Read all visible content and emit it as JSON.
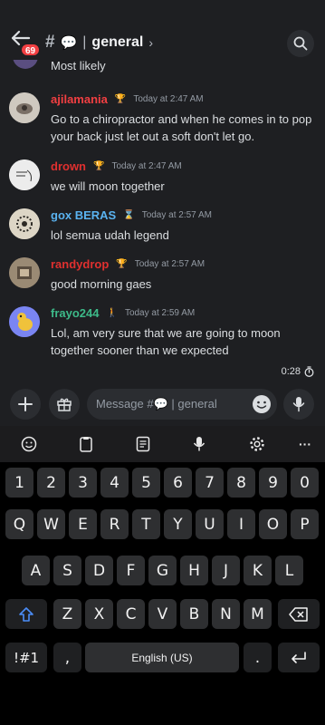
{
  "header": {
    "badge": "69",
    "channel_emoji": "💬",
    "separator": "|",
    "channel_name": "general",
    "chevron": "›"
  },
  "chat": {
    "previous_text": "Most likely",
    "messages": [
      {
        "username": "ajilamania",
        "color": "#f23f42",
        "role_icon": "🏆",
        "time": "Today at 2:47 AM",
        "text": "Go to a chiropractor and when he comes in to pop your back just let out a soft don't let go."
      },
      {
        "username": "drown",
        "color": "#e0302f",
        "role_icon": "🏆",
        "time": "Today at 2:47 AM",
        "text": "we will moon together"
      },
      {
        "username": "gox BERAS",
        "color": "#5ab3f0",
        "role_icon": "⌛",
        "time": "Today at 2:57 AM",
        "text": "lol semua udah legend"
      },
      {
        "username": "randydrop",
        "color": "#e0302f",
        "role_icon": "🏆",
        "time": "Today at 2:57 AM",
        "text": "good morning gaes"
      },
      {
        "username": "frayo244",
        "color": "#3dba89",
        "role_icon": "🚶",
        "time": "Today at 2:59 AM",
        "text": "Lol, am very sure that we are going to moon together sooner than we expected"
      }
    ],
    "timer": "0:28"
  },
  "composer": {
    "placeholder": "Message #💬 | general"
  },
  "keyboard": {
    "toolbar_icons": [
      "emoji-icon",
      "clipboard-icon",
      "keyboard-layout-icon",
      "mic-icon",
      "settings-icon",
      "more-icon"
    ],
    "more_label": "···",
    "row1": [
      "1",
      "2",
      "3",
      "4",
      "5",
      "6",
      "7",
      "8",
      "9",
      "0"
    ],
    "row2": [
      "Q",
      "W",
      "E",
      "R",
      "T",
      "Y",
      "U",
      "I",
      "O",
      "P"
    ],
    "row3": [
      "A",
      "S",
      "D",
      "F",
      "G",
      "H",
      "J",
      "K",
      "L"
    ],
    "row4": [
      "Z",
      "X",
      "C",
      "V",
      "B",
      "N",
      "M"
    ],
    "symbols": "!#1",
    "comma": ",",
    "space": "English (US)",
    "period": "."
  }
}
